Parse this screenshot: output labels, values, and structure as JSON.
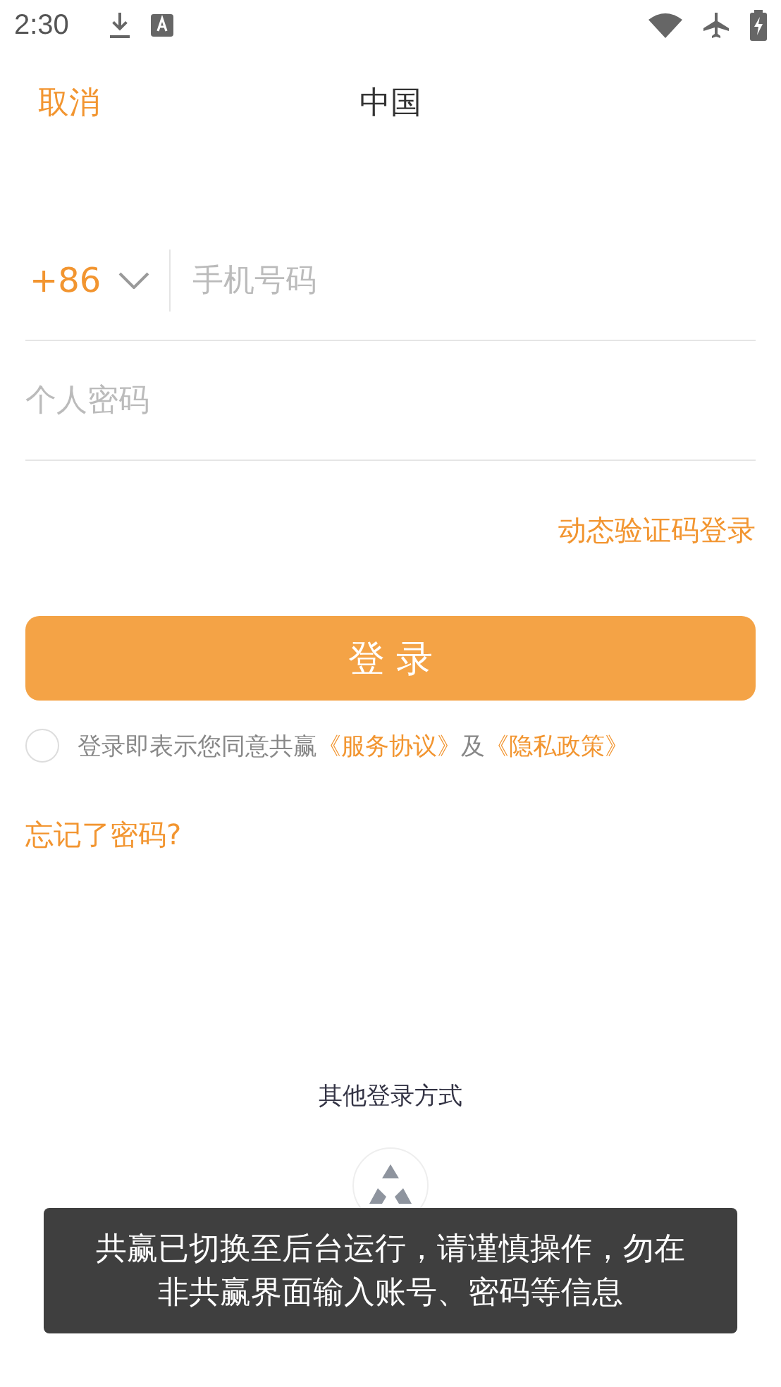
{
  "status_bar": {
    "time": "2:30"
  },
  "header": {
    "cancel": "取消",
    "title": "中国"
  },
  "phone": {
    "country_code": "+86",
    "placeholder": "手机号码"
  },
  "password": {
    "placeholder": "个人密码"
  },
  "sms_login_link": "动态验证码登录",
  "login_button": "登 录",
  "agreement": {
    "checked": false,
    "text": "登录即表示您同意共赢",
    "terms_link": "《服务协议》",
    "and": "及",
    "privacy_link": "《隐私政策》"
  },
  "forgot_password": "忘记了密码?",
  "other_login": {
    "title": "其他登录方式"
  },
  "toast": "共赢已切换至后台运行，请谨慎操作，勿在非共赢界面输入账号、密码等信息"
}
